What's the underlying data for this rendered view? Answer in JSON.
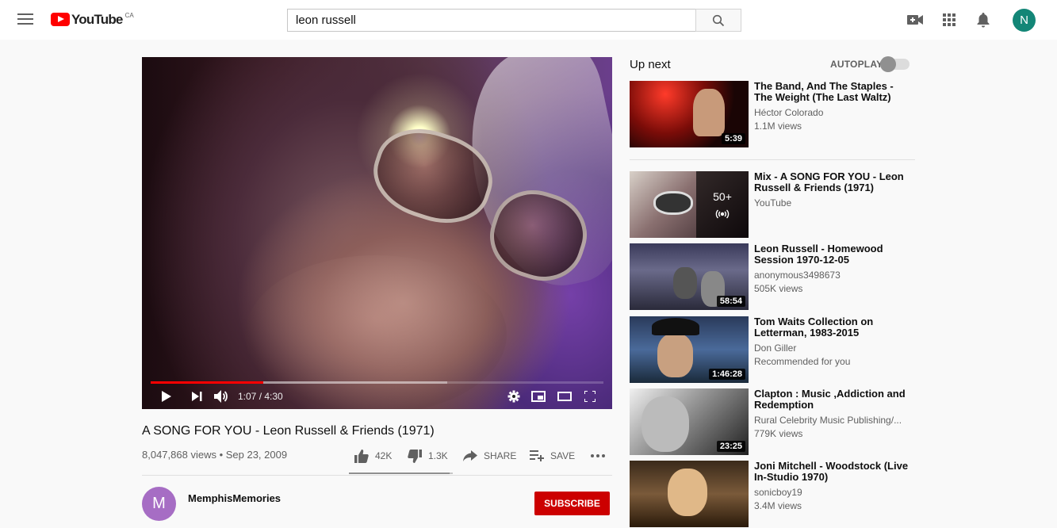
{
  "header": {
    "logo_text": "YouTube",
    "region": "CA",
    "search_value": "leon russell"
  },
  "player": {
    "time_readout": "1:07 / 4:30",
    "progress": 0.248,
    "buffered": 0.655
  },
  "video": {
    "title": "A SONG FOR YOU - Leon Russell & Friends (1971)",
    "meta": "8,047,868 views • Sep 23, 2009",
    "likes": "42K",
    "dislikes": "1.3K",
    "share_label": "SHARE",
    "save_label": "SAVE",
    "like_ratio": 0.97,
    "channel_initial": "M",
    "channel_name": "MemphisMemories",
    "subscribe_label": "SUBSCRIBE"
  },
  "sidebar": {
    "up_next_label": "Up next",
    "autoplay_label": "AUTOPLAY",
    "autoplay_on": false,
    "items": [
      {
        "title": "The Band, And The Staples - The Weight (The Last Waltz)",
        "channel": "Héctor Colorado",
        "views": "1.1M views",
        "duration": "5:39"
      },
      {
        "title": "Mix - A SONG FOR YOU - Leon Russell & Friends (1971)",
        "channel": "YouTube",
        "views": "",
        "mix_count": "50+"
      },
      {
        "title": "Leon Russell - Homewood Session 1970-12-05",
        "channel": "anonymous3498673",
        "views": "505K views",
        "duration": "58:54"
      },
      {
        "title": "Tom Waits Collection on Letterman, 1983-2015",
        "channel": "Don Giller",
        "views": "Recommended for you",
        "duration": "1:46:28"
      },
      {
        "title": "Clapton : Music ,Addiction and Redemption",
        "channel": "Rural Celebrity Music Publishing/...",
        "views": "779K views",
        "duration": "23:25"
      },
      {
        "title": "Joni Mitchell - Woodstock (Live In-Studio 1970)",
        "channel": "sonicboy19",
        "views": "3.4M views"
      }
    ]
  },
  "colors": {
    "brand_red": "#ff0000",
    "subscribe_red": "#cc0000",
    "avatar_user": "#138677",
    "avatar_channel": "#a66dc4"
  }
}
